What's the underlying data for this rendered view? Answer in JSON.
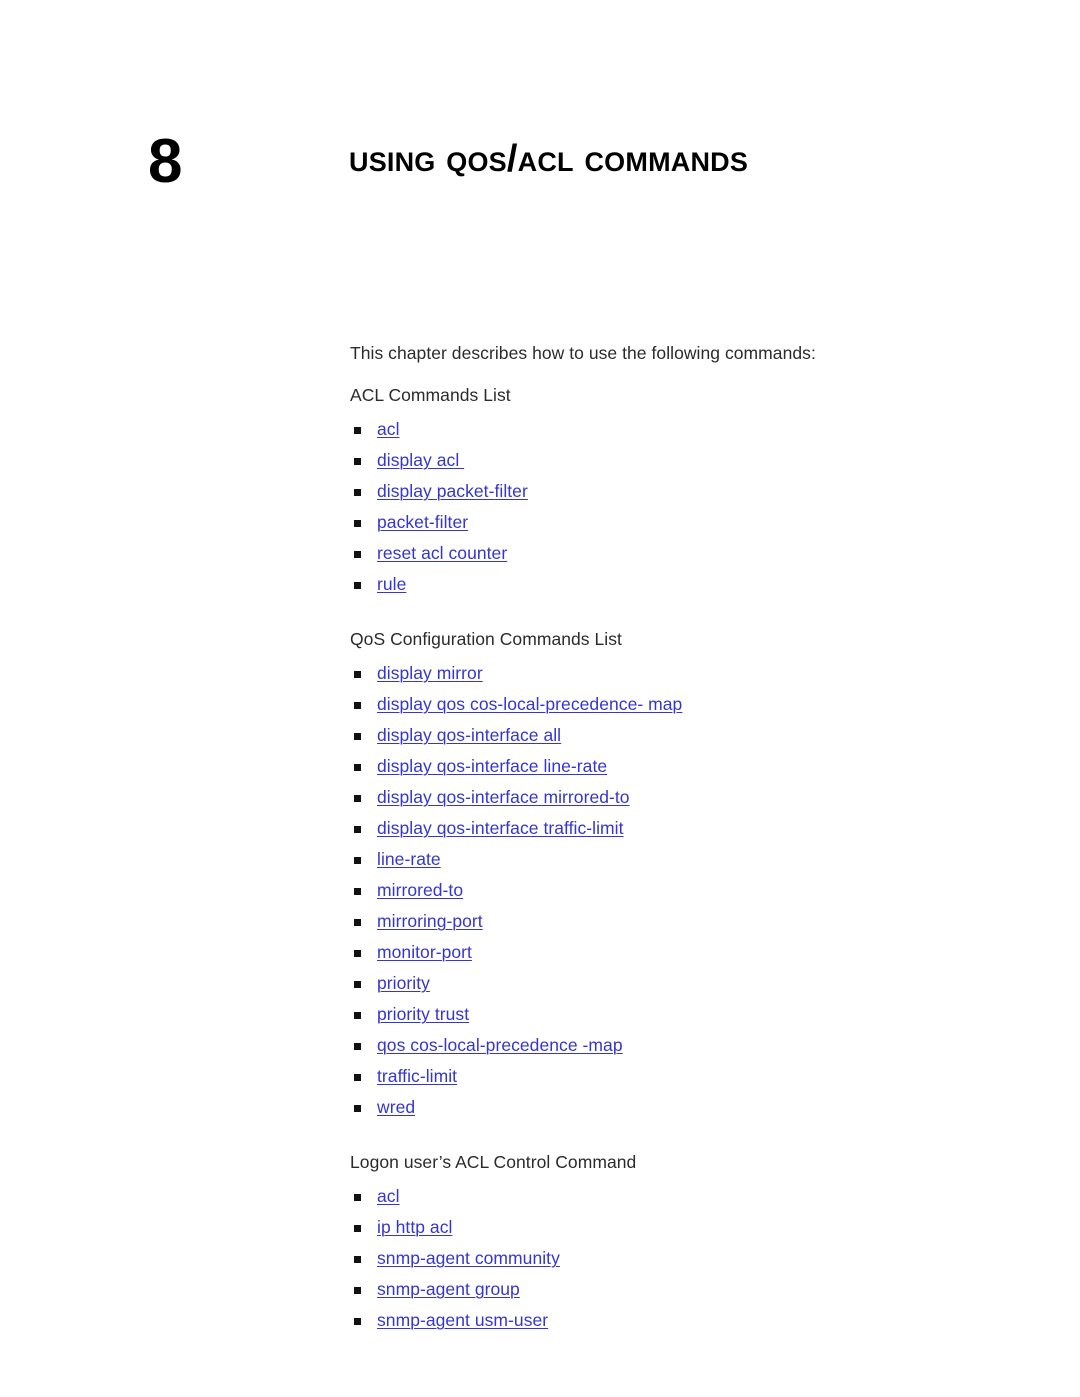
{
  "chapter": {
    "number": "8",
    "title": "Using QoS/ACL Commands"
  },
  "intro": "This chapter describes how to use the following commands:",
  "sections": [
    {
      "heading": "ACL Commands List",
      "items": [
        "acl",
        "display acl ",
        "display packet-filter",
        "packet-filter",
        "reset acl counter",
        "rule"
      ]
    },
    {
      "heading": "QoS Configuration Commands List",
      "items": [
        "display mirror",
        "display qos cos-local-precedence- map",
        "display qos-interface all",
        "display qos-interface line-rate",
        "display qos-interface mirrored-to",
        "display qos-interface traffic-limit",
        "line-rate",
        "mirrored-to",
        "mirroring-port",
        "monitor-port",
        "priority",
        "priority trust",
        "qos cos-local-precedence -map",
        "traffic-limit",
        "wred"
      ]
    },
    {
      "heading": "Logon user’s ACL Control Command",
      "items": [
        "acl",
        "ip http acl",
        "snmp-agent community",
        "snmp-agent group",
        "snmp-agent usm-user"
      ]
    }
  ],
  "colors": {
    "link": "#3535cf",
    "text": "#2b2b2b",
    "heading": "#000000",
    "bullet": "#111111",
    "background": "#ffffff"
  }
}
